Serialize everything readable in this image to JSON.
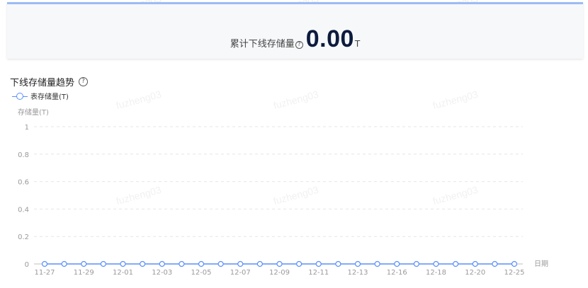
{
  "summary": {
    "label": "累计下线存储量",
    "value": "0.00",
    "unit": "T"
  },
  "section": {
    "title": "下线存储量趋势"
  },
  "watermark_text": "fuzheng03",
  "colors": {
    "accent": "#9cbcf4",
    "series": "#5b8ff9",
    "value_text": "#0d1b3e"
  },
  "chart_data": {
    "type": "line",
    "ylabel": "存储量(T)",
    "xlabel": "日期",
    "ylim": [
      0,
      1
    ],
    "yticks": [
      "1",
      "0.8",
      "0.6",
      "0.4",
      "0.2",
      "0"
    ],
    "x_tick_labels": [
      "11-27",
      "11-29",
      "12-01",
      "12-03",
      "12-05",
      "12-07",
      "12-09",
      "12-11",
      "12-13",
      "12-16",
      "12-18",
      "12-20",
      "12-25"
    ],
    "grid": true,
    "legend": "top-left",
    "series": [
      {
        "name": "表存储量(T)",
        "values": [
          0,
          0,
          0,
          0,
          0,
          0,
          0,
          0,
          0,
          0,
          0,
          0,
          0,
          0,
          0,
          0,
          0,
          0,
          0,
          0,
          0,
          0,
          0,
          0,
          0
        ]
      }
    ]
  }
}
